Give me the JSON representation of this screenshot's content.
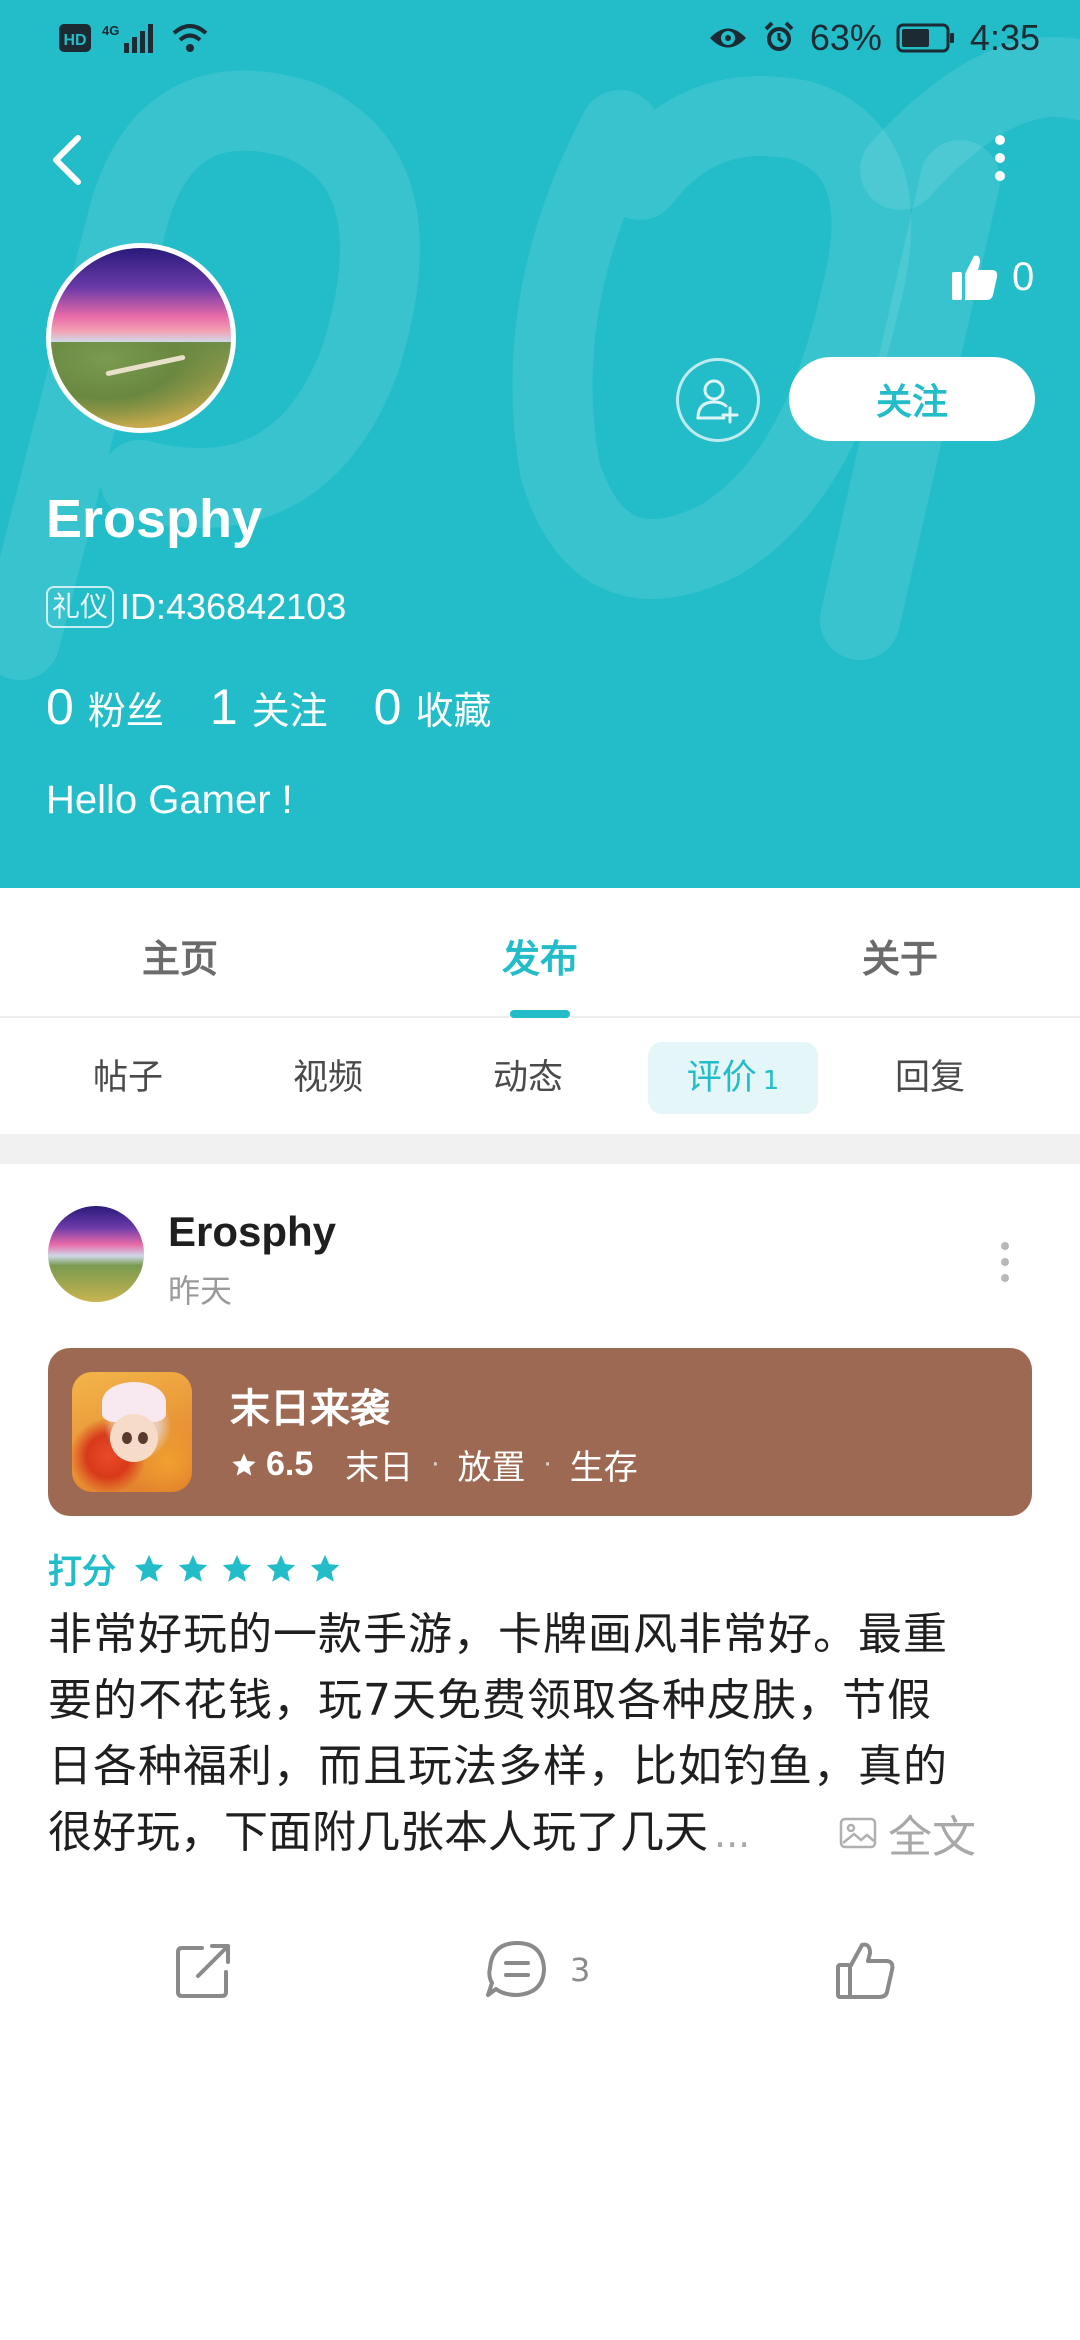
{
  "status_bar": {
    "network": "HD",
    "signal": "4G",
    "battery_pct": "63%",
    "time": "4:35"
  },
  "profile": {
    "like_count": "0",
    "follow_label": "关注",
    "username": "Erosphy",
    "badge": "礼仪",
    "id_text": "ID:436842103",
    "stats": [
      {
        "num": "0",
        "label": "粉丝"
      },
      {
        "num": "1",
        "label": "关注"
      },
      {
        "num": "0",
        "label": "收藏"
      }
    ],
    "bio": "Hello Gamer !"
  },
  "tabs": {
    "main": [
      "主页",
      "发布",
      "关于"
    ],
    "active_main": "发布",
    "sub": [
      {
        "label": "帖子",
        "count": ""
      },
      {
        "label": "视频",
        "count": ""
      },
      {
        "label": "动态",
        "count": ""
      },
      {
        "label": "评价",
        "count": "1"
      },
      {
        "label": "回复",
        "count": ""
      }
    ],
    "active_sub": "评价"
  },
  "post": {
    "author": "Erosphy",
    "time": "昨天",
    "game": {
      "title": "末日来袭",
      "score": "6.5",
      "tags": [
        "末日",
        "放置",
        "生存"
      ]
    },
    "rating_label": "打分",
    "rating_stars": 5,
    "review_lines": [
      "非常好玩的一款手游，卡牌画风非常好。最重",
      "要的不花钱，玩7天免费领取各种皮肤，节假",
      "日各种福利，而且玩法多样，比如钓鱼，真的",
      "很好玩，下面附几张本人玩了几天"
    ],
    "ellipsis": "...",
    "fulltext_label": "全文",
    "comment_count": "3"
  },
  "colors": {
    "accent": "#22bdc9",
    "card_bg": "#9e6953",
    "sub_tab_active_bg": "#e4f6f8"
  }
}
